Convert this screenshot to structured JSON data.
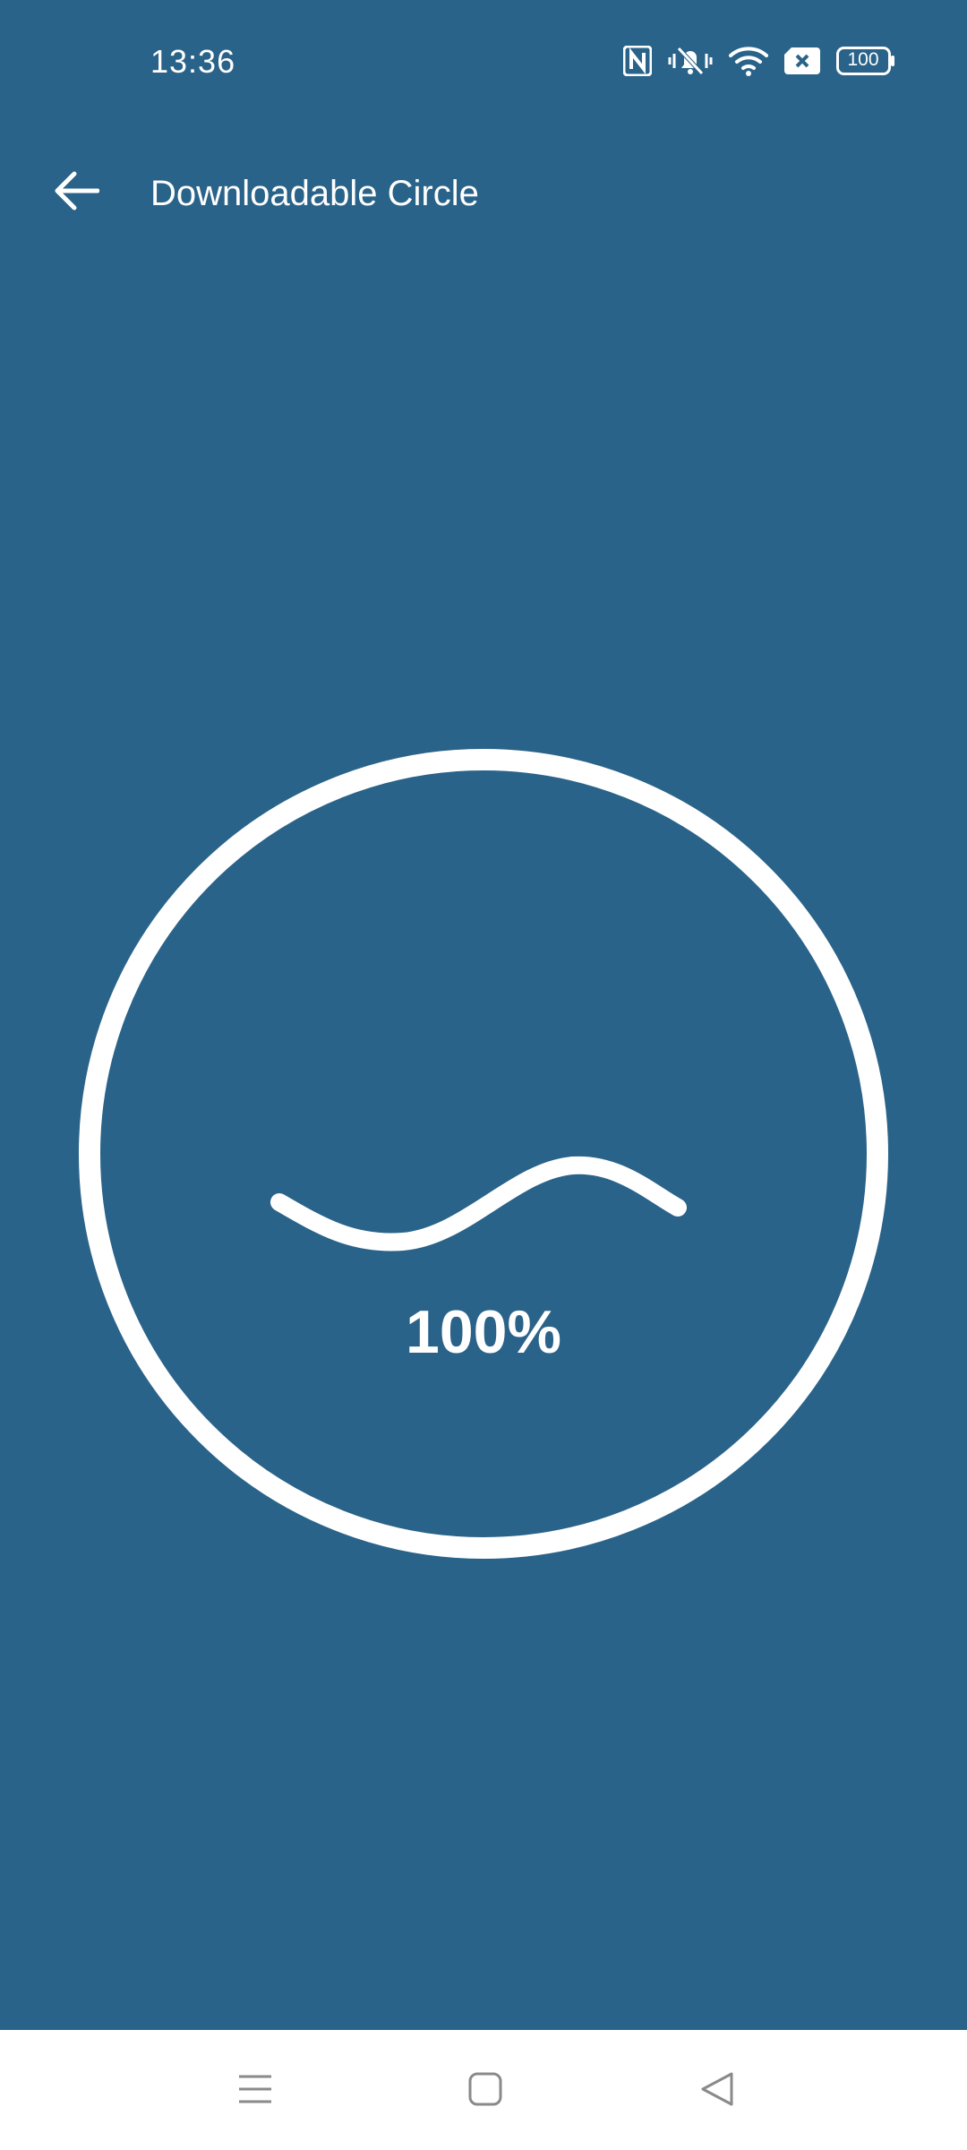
{
  "status_bar": {
    "time": "13:36",
    "battery": "100",
    "icons": [
      "nfc-icon",
      "mute-vibrate-icon",
      "wifi-icon",
      "sim-off-icon",
      "battery-icon"
    ]
  },
  "app_bar": {
    "title": "Downloadable Circle",
    "back_icon": "arrow-left-icon"
  },
  "progress": {
    "percent_text": "100%",
    "value": 100
  },
  "nav_bar": {
    "buttons": [
      "menu-icon",
      "home-icon",
      "back-triangle-icon"
    ]
  },
  "colors": {
    "background": "#2a6389",
    "foreground": "#ffffff",
    "nav_bar": "#ffffff",
    "nav_icons": "#8a8a8a"
  }
}
